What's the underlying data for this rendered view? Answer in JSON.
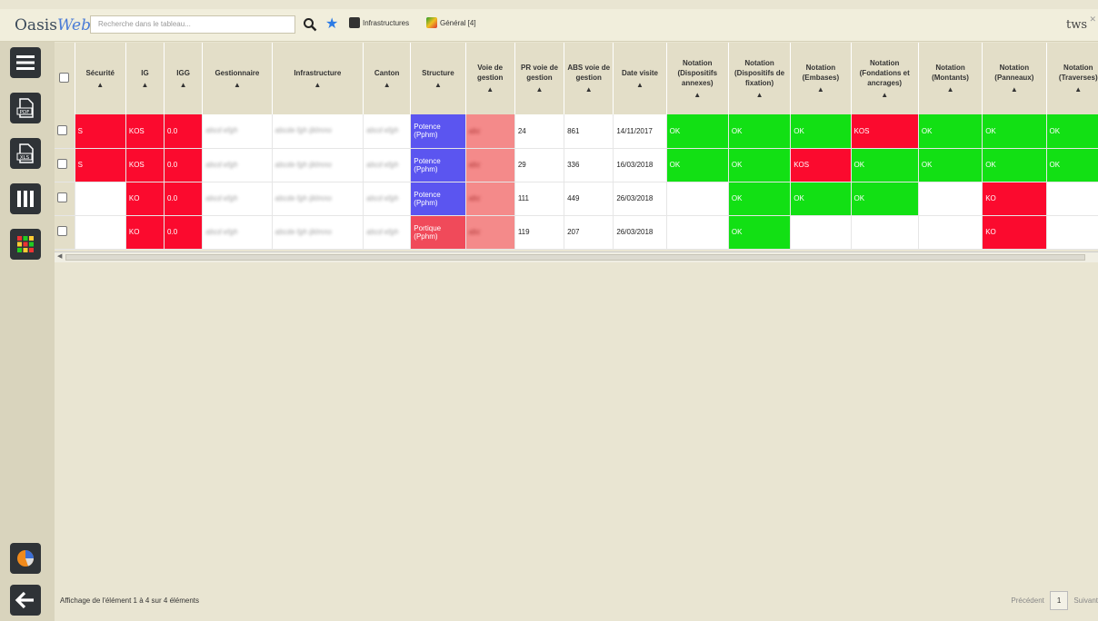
{
  "app": {
    "name_main": "Oasis",
    "name_web": "Web",
    "user": "tws"
  },
  "search": {
    "placeholder": "Recherche dans le tableau..."
  },
  "chips": {
    "infrastructures": "Infrastructures",
    "general": "Général [4]"
  },
  "columns": [
    {
      "label": "Sécurité",
      "w": 56
    },
    {
      "label": "IG",
      "w": 42
    },
    {
      "label": "IGG",
      "w": 42
    },
    {
      "label": "Gestionnaire",
      "w": 76
    },
    {
      "label": "Infrastructure",
      "w": 100
    },
    {
      "label": "Canton",
      "w": 52
    },
    {
      "label": "Structure",
      "w": 60
    },
    {
      "label": "Voie de gestion",
      "w": 54
    },
    {
      "label": "PR voie de gestion",
      "w": 54
    },
    {
      "label": "ABS voie de gestion",
      "w": 54
    },
    {
      "label": "Date visite",
      "w": 58
    },
    {
      "label": "Notation (Dispositifs annexes)",
      "w": 68
    },
    {
      "label": "Notation (Dispositifs de fixation)",
      "w": 68
    },
    {
      "label": "Notation (Embases)",
      "w": 66
    },
    {
      "label": "Notation (Fondations et ancrages)",
      "w": 74
    },
    {
      "label": "Notation (Montants)",
      "w": 70
    },
    {
      "label": "Notation (Panneaux)",
      "w": 70
    },
    {
      "label": "Notation (Traverses)",
      "w": 70
    }
  ],
  "rows": [
    {
      "cells": [
        "S",
        "KOS",
        "0.0",
        "abcd efgh",
        "abcde fgh ijklmno",
        "abcd efgh",
        "Potence (Pphm)",
        "abc",
        "24",
        "861",
        "14/11/2017",
        "OK",
        "OK",
        "OK",
        "KOS",
        "OK",
        "OK",
        "OK"
      ],
      "colors": [
        "red",
        "red",
        "red",
        "",
        "",
        "",
        "blue",
        "salmon",
        "",
        "",
        "",
        "green",
        "green",
        "green",
        "red",
        "green",
        "green",
        "green"
      ]
    },
    {
      "cells": [
        "S",
        "KOS",
        "0.0",
        "abcd efgh",
        "abcde fgh ijklmno",
        "abcd efgh",
        "Potence (Pphm)",
        "abc",
        "29",
        "336",
        "16/03/2018",
        "OK",
        "OK",
        "KOS",
        "OK",
        "OK",
        "OK",
        "OK"
      ],
      "colors": [
        "red",
        "red",
        "red",
        "",
        "",
        "",
        "blue",
        "salmon",
        "",
        "",
        "",
        "green",
        "green",
        "red",
        "green",
        "green",
        "green",
        "green"
      ]
    },
    {
      "cells": [
        "",
        "KO",
        "0.0",
        "abcd efgh",
        "abcde fgh ijklmno",
        "abcd efgh",
        "Potence (Pphm)",
        "abc",
        "111",
        "449",
        "26/03/2018",
        "",
        "OK",
        "OK",
        "OK",
        "",
        "KO",
        ""
      ],
      "colors": [
        "",
        "red",
        "red",
        "",
        "",
        "",
        "blue",
        "salmon",
        "",
        "",
        "",
        "",
        "green",
        "green",
        "green",
        "",
        "red",
        ""
      ]
    },
    {
      "cells": [
        "",
        "KO",
        "0.0",
        "abcd efgh",
        "abcde fgh ijklmno",
        "abcd efgh",
        "Portique (Pphm)",
        "abc",
        "119",
        "207",
        "26/03/2018",
        "",
        "OK",
        "",
        "",
        "",
        "KO",
        ""
      ],
      "colors": [
        "",
        "red",
        "red",
        "",
        "",
        "",
        "pinkred",
        "salmon",
        "",
        "",
        "",
        "",
        "green",
        "",
        "",
        "",
        "red",
        ""
      ]
    }
  ],
  "blurred_cols": [
    3,
    4,
    5,
    7
  ],
  "footer": {
    "info": "Affichage de l'élément 1 à 4 sur 4 éléments",
    "prev": "Précédent",
    "page": "1",
    "next": "Suivant"
  }
}
